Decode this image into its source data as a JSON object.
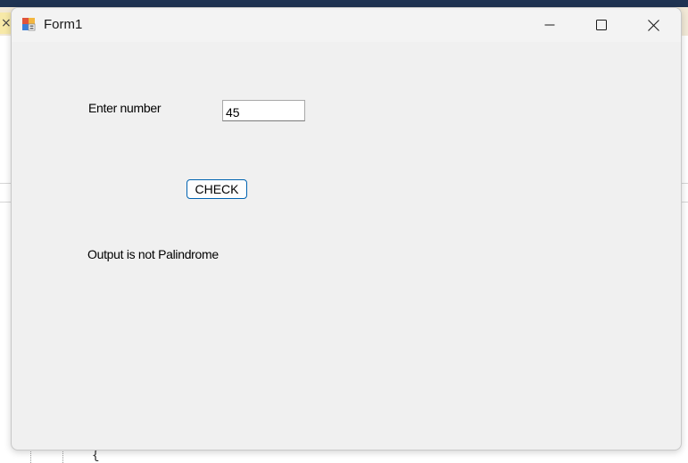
{
  "window": {
    "title": "Form1",
    "icon": "winforms-app-icon",
    "controls": {
      "minimize_icon": "minimize-icon",
      "maximize_icon": "maximize-icon",
      "close_icon": "close-icon"
    }
  },
  "form": {
    "input_label": "Enter number",
    "input_value": "45",
    "check_button_label": "CHECK",
    "output_text": "Output is not Palindrome"
  },
  "background": {
    "tab_close_glyph": "×",
    "code_brace": "{"
  },
  "colors": {
    "form_background": "#f0f0f0",
    "button_focus_border": "#0063b1"
  }
}
